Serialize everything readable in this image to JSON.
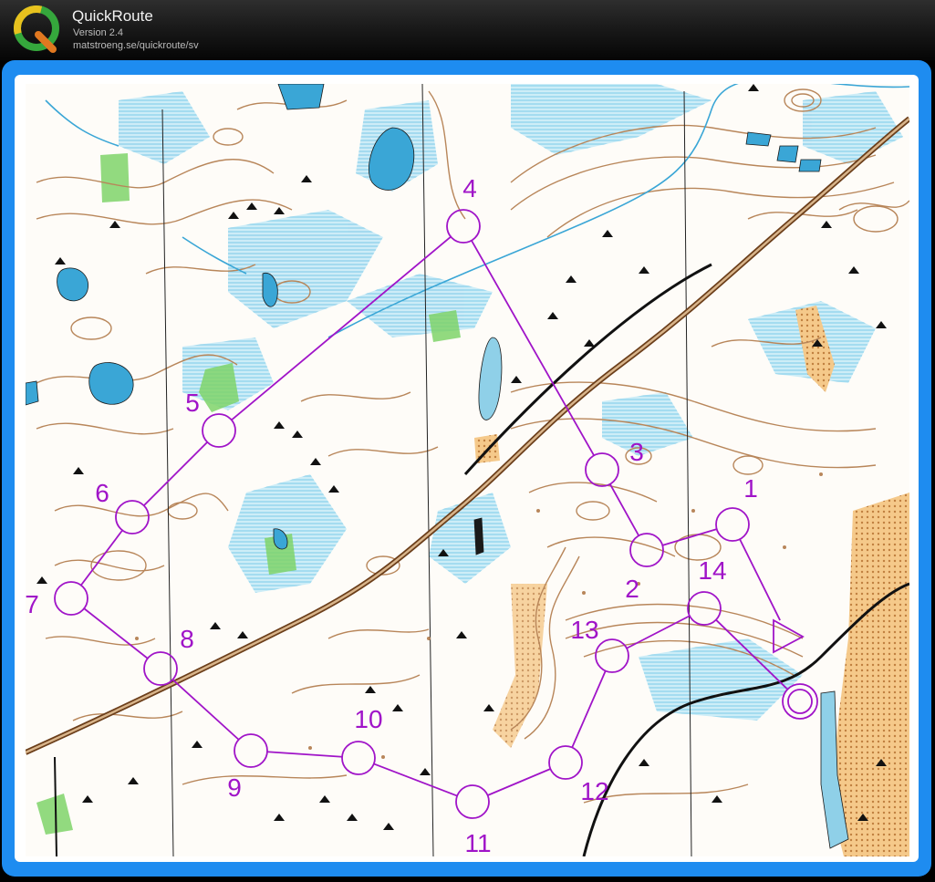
{
  "app": {
    "title": "QuickRoute",
    "version": "Version 2.4",
    "url": "matstroeng.se/quickroute/sv",
    "logo_letter": "Q"
  },
  "colors": {
    "frame": "#1e8cf0",
    "course": "#a014c8",
    "contour": "#b8865a",
    "water": "#3aa6d6",
    "marsh": "#8fd0e8",
    "green": "#6ccf5a",
    "road": "#8a5a2e",
    "rock": "#111111",
    "yellow": "#f0a850"
  },
  "course": {
    "controls": [
      {
        "label": "1"
      },
      {
        "label": "2"
      },
      {
        "label": "3"
      },
      {
        "label": "4"
      },
      {
        "label": "5"
      },
      {
        "label": "6"
      },
      {
        "label": "7"
      },
      {
        "label": "8"
      },
      {
        "label": "9"
      },
      {
        "label": "10"
      },
      {
        "label": "11"
      },
      {
        "label": "12"
      },
      {
        "label": "13"
      },
      {
        "label": "14"
      }
    ]
  }
}
